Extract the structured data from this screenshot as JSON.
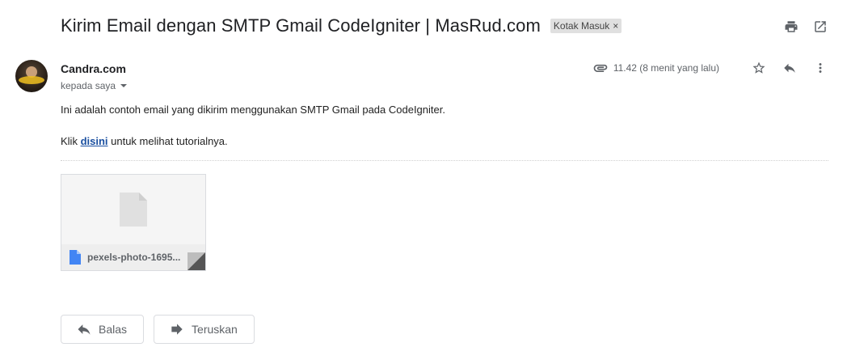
{
  "email": {
    "subject": "Kirim Email dengan SMTP Gmail CodeIgniter | MasRud.com",
    "label": "Kotak Masuk",
    "label_remove": "×",
    "sender": "Candra.com",
    "recipient": "kepada saya",
    "time": "11.42 (8 menit yang lalu)",
    "body": {
      "line1": "Ini adalah contoh email yang dikirim menggunakan SMTP Gmail pada CodeIgniter.",
      "line2_prefix": "Klik ",
      "line2_link": "disini",
      "line2_suffix": " untuk melihat tutorialnya."
    }
  },
  "attachment": {
    "name": "pexels-photo-1695...",
    "icon": "file-icon"
  },
  "actions": {
    "reply": "Balas",
    "forward": "Teruskan"
  },
  "icons": {
    "print": "print-icon",
    "open_new": "open-in-new-icon",
    "attachment": "paperclip-icon",
    "star": "star-icon",
    "reply": "reply-icon",
    "more": "more-vert-icon"
  },
  "colors": {
    "link": "#1a4fa0",
    "label_bg": "#e0e0e0",
    "file_icon": "#4285f4"
  }
}
